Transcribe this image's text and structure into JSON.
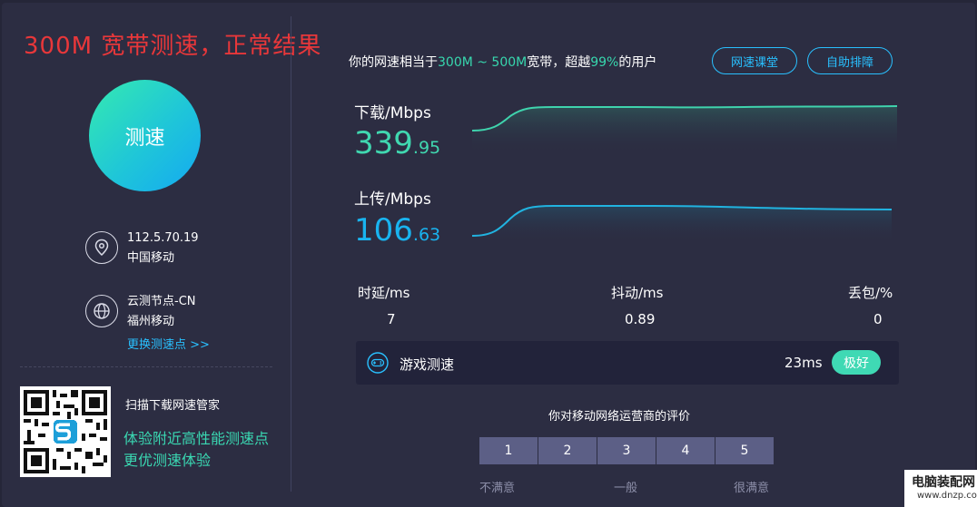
{
  "headline": "300M 宽带测速，正常结果",
  "speed_button": {
    "label": "测速"
  },
  "client": {
    "ip": "112.5.70.19",
    "isp": "中国移动"
  },
  "node": {
    "name": "云测节点-CN",
    "location": "福州移动",
    "change_link": "更换测速点 >>"
  },
  "promo": {
    "title": "扫描下载网速管家",
    "line1": "体验附近高性能测速点",
    "line2": "更优测速体验"
  },
  "summary": {
    "prefix": "你的网速相当于",
    "range": "300M ~ 500M",
    "middle": "宽带，超越",
    "percent": "99%",
    "suffix": "的用户"
  },
  "buttons": {
    "course": "网速课堂",
    "troubleshoot": "自助排障"
  },
  "download": {
    "label": "下载/Mbps",
    "int": "339",
    "dec": ".95"
  },
  "upload": {
    "label": "上传/Mbps",
    "int": "106",
    "dec": ".63"
  },
  "stats": {
    "latency": {
      "label": "时延/ms",
      "value": "7"
    },
    "jitter": {
      "label": "抖动/ms",
      "value": "0.89"
    },
    "loss": {
      "label": "丢包/%",
      "value": "0"
    }
  },
  "game": {
    "label": "游戏测速",
    "ms": "23ms",
    "badge": "极好"
  },
  "rating": {
    "title": "你对移动网络运营商的评价",
    "options": [
      "1",
      "2",
      "3",
      "4",
      "5"
    ],
    "low": "不满意",
    "mid": "一般",
    "high": "很满意"
  },
  "watermark": {
    "cn": "电脑装配网",
    "en": "www.dnzp.com"
  },
  "colors": {
    "accent_green": "#37d7ae",
    "accent_blue": "#29c0ff",
    "headline_red": "#e8373a"
  },
  "icons": {
    "location": "map-pin-icon",
    "node": "globe-icon",
    "game": "gamepad-icon"
  }
}
